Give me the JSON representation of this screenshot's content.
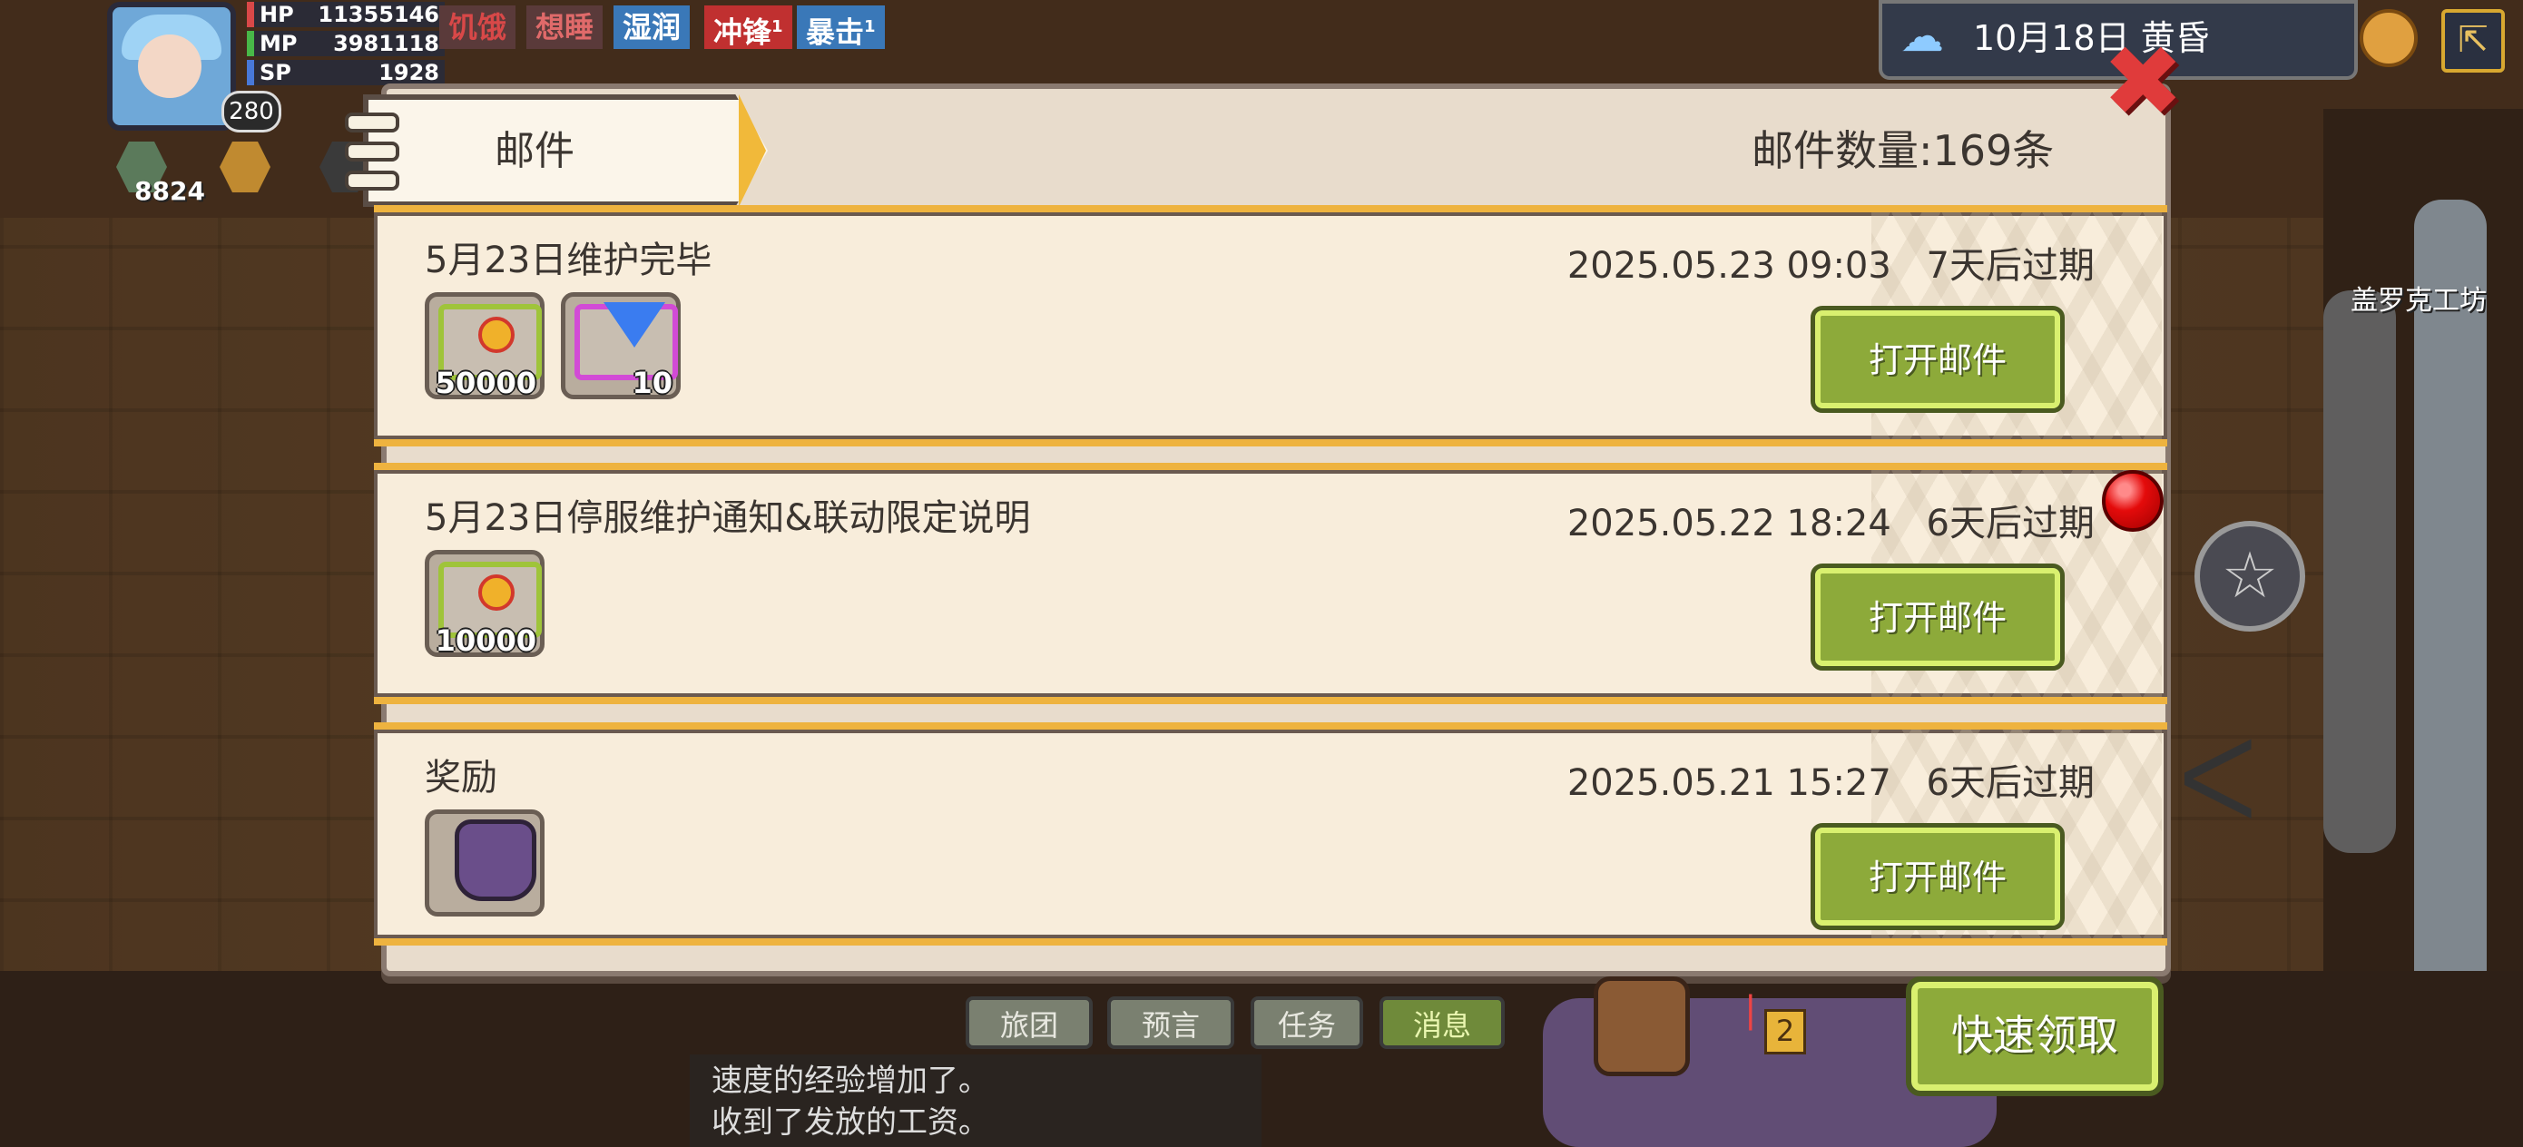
{
  "hud": {
    "stats": [
      {
        "key": "HP",
        "value": "11355146"
      },
      {
        "key": "MP",
        "value": "3981118"
      },
      {
        "key": "SP",
        "value": "1928"
      }
    ],
    "level": "280",
    "statuses": [
      {
        "label": "饥饿",
        "sup": "",
        "color": "#d84848",
        "bg": "#5a3a3a"
      },
      {
        "label": "想睡",
        "sup": "",
        "color": "#e06a6a",
        "bg": "#5a3a3a"
      },
      {
        "label": "湿润",
        "sup": "",
        "color": "#ffffff",
        "bg": "#3a78b8"
      },
      {
        "label": "冲锋",
        "sup": "1",
        "color": "#ffffff",
        "bg": "#c03030"
      },
      {
        "label": "暴击",
        "sup": "1",
        "color": "#ffffff",
        "bg": "#3a78b8"
      }
    ],
    "badge_value": "8824",
    "weather_text": "10月18日  黄昏",
    "shop_label": "盖罗克工坊"
  },
  "mail": {
    "tab_title": "邮件",
    "count_label": "邮件数量:169条",
    "items": [
      {
        "title": "5月23日维护完毕",
        "date": "2025.05.23 09:03",
        "expiry": "7天后过期",
        "button": "打开邮件",
        "attachments": [
          {
            "icon": "gold-coin-icon",
            "qty": "50000"
          },
          {
            "icon": "blue-gem-icon",
            "qty": "10"
          }
        ]
      },
      {
        "title": "5月23日停服维护通知&联动限定说明",
        "date": "2025.05.22 18:24",
        "expiry": "6天后过期",
        "button": "打开邮件",
        "attachments": [
          {
            "icon": "gold-coin-icon",
            "qty": "10000"
          }
        ]
      },
      {
        "title": "奖励",
        "date": "2025.05.21 15:27",
        "expiry": "6天后过期",
        "button": "打开邮件",
        "attachments": [
          {
            "icon": "item-bag-icon",
            "qty": ""
          }
        ]
      }
    ],
    "quick_claim": "快速领取"
  },
  "bottom_tabs": [
    "旅团",
    "预言",
    "任务",
    "消息"
  ],
  "active_tab": "消息",
  "chat_lines": [
    "速度的经验增加了。",
    "收到了发放的工资。"
  ],
  "notif_count": "2"
}
